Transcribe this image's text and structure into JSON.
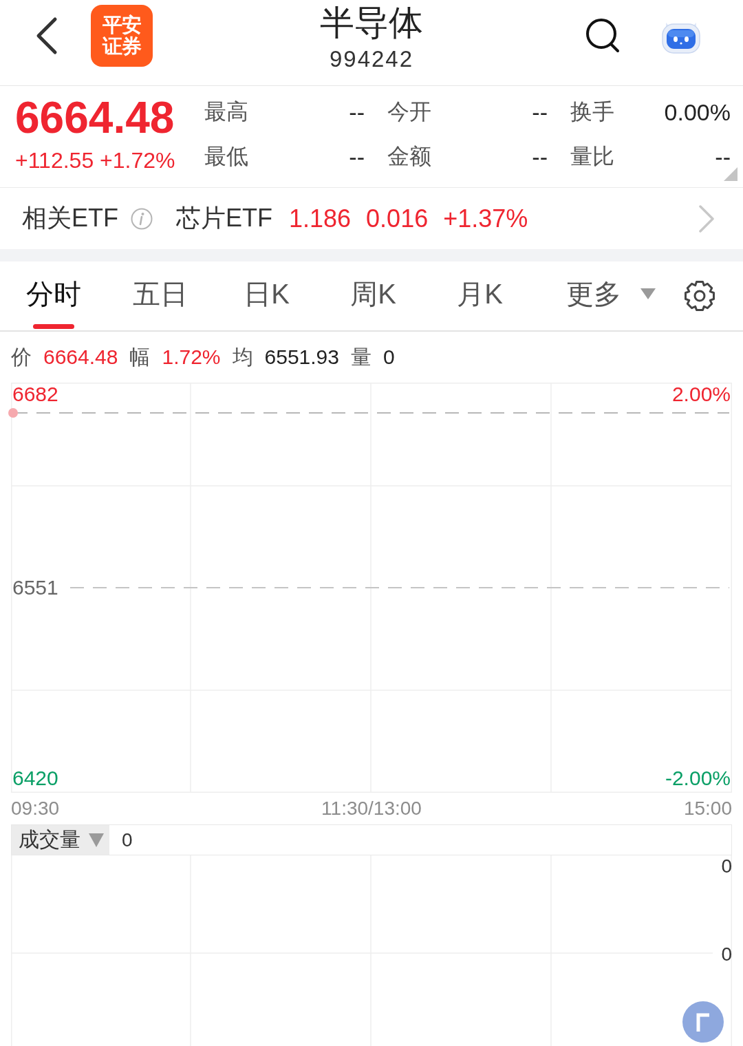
{
  "header": {
    "logo_text": [
      "平安",
      "证券"
    ],
    "title": "半导体",
    "code": "994242"
  },
  "quote": {
    "price": "6664.48",
    "change": "+112.55",
    "change_pct": "+1.72%",
    "color": "#ef2530",
    "stats": [
      {
        "label": "最高",
        "value": "--"
      },
      {
        "label": "今开",
        "value": "--"
      },
      {
        "label": "换手",
        "value": "0.00%"
      },
      {
        "label": "最低",
        "value": "--"
      },
      {
        "label": "金额",
        "value": "--"
      },
      {
        "label": "量比",
        "value": "--"
      }
    ]
  },
  "etf": {
    "label": "相关ETF",
    "name": "芯片ETF",
    "price": "1.186",
    "change": "0.016",
    "change_pct": "+1.37%",
    "color": "#ef2530"
  },
  "tabs": [
    {
      "label": "分时",
      "selected": true,
      "kind": "tab"
    },
    {
      "label": "五日",
      "selected": false,
      "kind": "tab"
    },
    {
      "label": "日K",
      "selected": false,
      "kind": "tab"
    },
    {
      "label": "周K",
      "selected": false,
      "kind": "tab"
    },
    {
      "label": "月K",
      "selected": false,
      "kind": "tab"
    },
    {
      "label": "更多",
      "selected": false,
      "kind": "dropdown"
    }
  ],
  "info_line": [
    {
      "label": "价",
      "value": "6664.48",
      "color": "#ef2530"
    },
    {
      "label": "幅",
      "value": "1.72%",
      "color": "#ef2530"
    },
    {
      "label": "均",
      "value": "6551.93",
      "color": "#222222"
    },
    {
      "label": "量",
      "value": "0",
      "color": "#222222"
    }
  ],
  "chart": {
    "levels": [
      {
        "price": "6682",
        "pct": "2.00%",
        "color": "#ef2530"
      },
      {
        "price": "6551",
        "color": "#666666"
      },
      {
        "price": "6420",
        "pct": "-2.00%",
        "color": "#0a9f66"
      }
    ],
    "times": [
      "09:30",
      "11:30/13:00",
      "15:00"
    ]
  },
  "volume": {
    "indicator": "成交量",
    "value": "0",
    "axis": [
      "0",
      "0"
    ]
  }
}
